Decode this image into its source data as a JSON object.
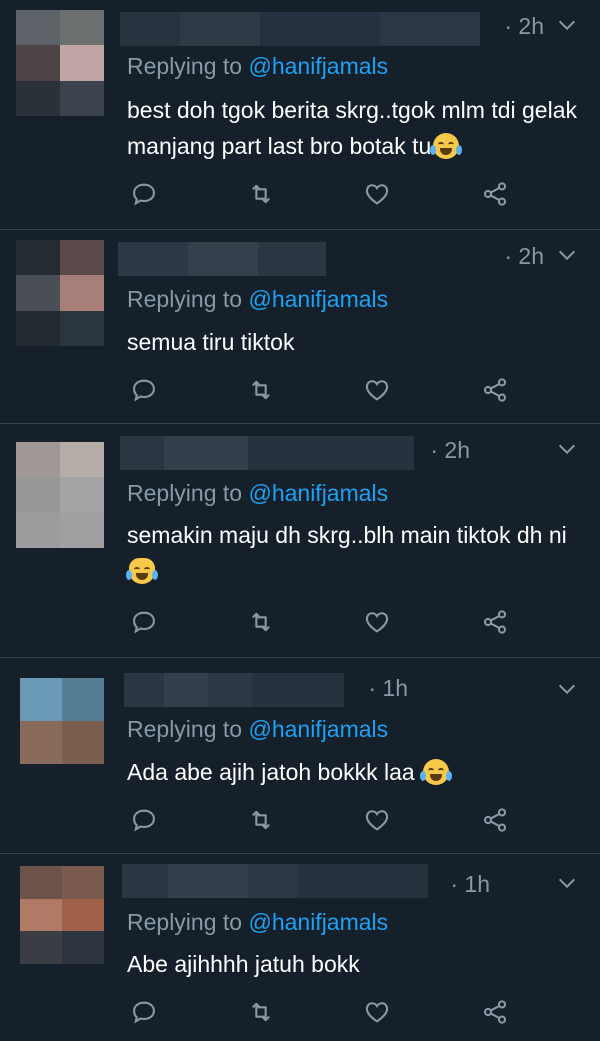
{
  "colors": {
    "background": "#15202b",
    "muted": "#8899a6",
    "link": "#1da1f2",
    "divider": "#38444d"
  },
  "tweets": [
    {
      "time": "· 2h",
      "replying_prefix": "Replying to ",
      "handle": "@hanifjamals",
      "text": "best doh tgok berita skrg..tgok mlm tdi gelak manjang part last bro botak tu",
      "emoji": "face-with-tears-of-joy-icon"
    },
    {
      "time": "· 2h",
      "replying_prefix": "Replying to ",
      "handle": "@hanifjamals",
      "text": "semua tiru tiktok",
      "emoji": ""
    },
    {
      "time": "· 2h",
      "replying_prefix": "Replying to ",
      "handle": "@hanifjamals",
      "text": "semakin maju dh skrg..blh main tiktok dh ni",
      "emoji": "cat-with-tears-of-joy-icon"
    },
    {
      "time": "· 1h",
      "replying_prefix": "Replying to ",
      "handle": "@hanifjamals",
      "text": "Ada abe ajih jatoh bokkk laa ",
      "emoji": "face-with-tears-of-joy-icon"
    },
    {
      "time": "· 1h",
      "replying_prefix": "Replying to ",
      "handle": "@hanifjamals",
      "text": "Abe ajihhhh jatuh bokk",
      "emoji": ""
    }
  ]
}
